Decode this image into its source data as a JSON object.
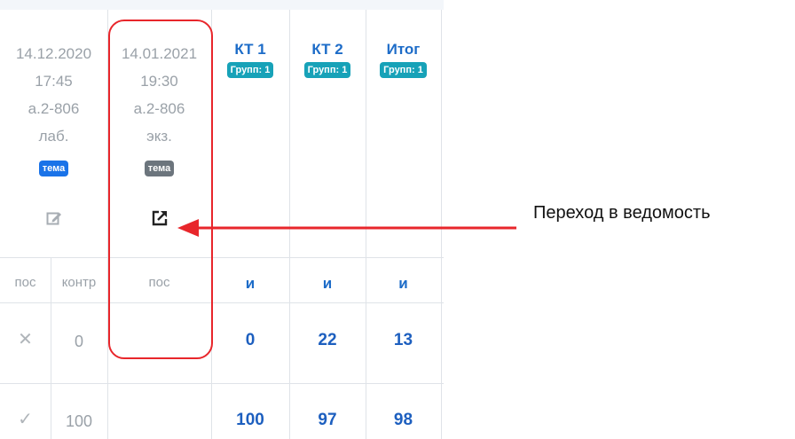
{
  "columns": {
    "col1": {
      "date": "14.12.2020",
      "time": "17:45",
      "room": "а.2-806",
      "type": "лаб.",
      "badge": "тема"
    },
    "col2": {
      "date": "14.01.2021",
      "time": "19:30",
      "room": "а.2-806",
      "type": "экз.",
      "badge": "тема"
    },
    "kt1": {
      "title": "КТ 1",
      "badge": "Групп: 1"
    },
    "kt2": {
      "title": "КТ 2",
      "badge": "Групп: 1"
    },
    "itog": {
      "title": "Итог",
      "badge": "Групп: 1"
    }
  },
  "subheaders": {
    "pos": "пос",
    "kontr": "контр",
    "col2": "пос",
    "kt1": "и",
    "kt2": "и",
    "itog": "и"
  },
  "rows": [
    {
      "mark": "✕",
      "kontr": "0",
      "kt1": "0",
      "kt2": "22",
      "itog": "13"
    },
    {
      "mark": "✓",
      "kontr": "100",
      "kt1": "100",
      "kt2": "97",
      "itog": "98"
    }
  ],
  "annotation": {
    "label": "Переход в ведомость",
    "arrow_color": "#e8262b"
  }
}
